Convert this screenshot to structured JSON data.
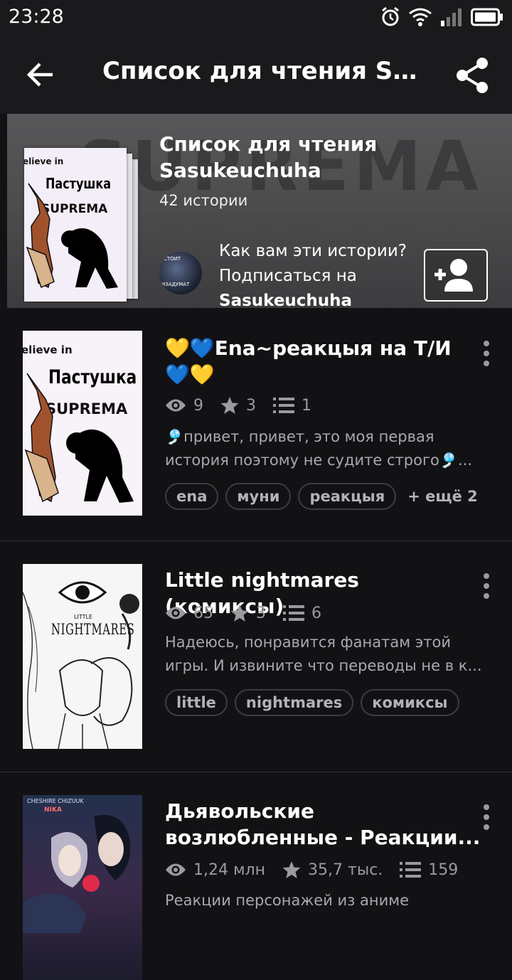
{
  "status_bar": {
    "time": "23:28"
  },
  "app_bar": {
    "title": "Список для чтения Sa..."
  },
  "header": {
    "cover_text": "Пастушка",
    "cover_brand": "SUPREMA",
    "cover_top": "elieve in",
    "title": "Список для чтения Sasukeuchuha",
    "count": "42 истории",
    "avatar_text_top": "СТОИТ",
    "avatar_text_bottom": "ИЗАДУМАТ",
    "ask_line": "Как вам эти истории?",
    "follow_prefix": "Подписаться на",
    "username": "Sasukeuchuha",
    "background_word": "SUPREMA"
  },
  "stories": [
    {
      "title_line1": "💛💙Ena~реакцыя на Т/И",
      "title_line2": "💙💛",
      "views": "9",
      "votes": "3",
      "parts": "1",
      "desc_line1": "🎐привет, привет, это моя первая",
      "desc_line2": "история поэтому не судите строго🎐...",
      "tags": [
        "ena",
        "муни",
        "реакцыя"
      ],
      "more_tags": "+ ещё 2",
      "cover_text": "Пастушка",
      "cover_brand": "SUPREMA",
      "cover_top": "elieve in"
    },
    {
      "title_line1": "Little nightmares (комиксы)",
      "views": "65",
      "votes": "3",
      "parts": "6",
      "desc_line1": "Надеюсь, понравится фанатам этой",
      "desc_line2": "игры. И извините что переводы не в к...",
      "tags": [
        "little",
        "nightmares",
        "комиксы"
      ],
      "cover_small": "LITTLE",
      "cover_big": "NIGHTMARES"
    },
    {
      "title_line1": "Дьявольские",
      "title_line2": "возлюбленные - Реакции...",
      "views": "1,24 млн",
      "votes": "35,7 тыс.",
      "parts": "159",
      "desc_line1": "Реакции персонажей из аниме",
      "cover_top": "CHESHIRE CHIZUUK",
      "cover_mid": "NIKA"
    }
  ],
  "colors": {
    "background": "#121214",
    "bar": "#1a1a1c",
    "meta": "#9b9b9f",
    "tag_border": "#3d3d41"
  }
}
